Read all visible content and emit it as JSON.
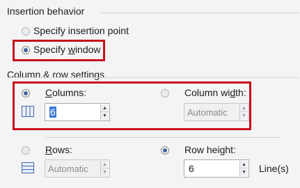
{
  "insertion": {
    "group_title": "Insertion behavior",
    "specify_point_label": "Specify insertion point",
    "specify_window_label_prefix": "Specify ",
    "specify_window_label_u": "w",
    "specify_window_label_suffix": "indow"
  },
  "colrow": {
    "group_title": "Column & row settings",
    "columns_label_u": "C",
    "columns_label_suffix": "olumns:",
    "columns_value": "6",
    "column_width_label_prefix": "Column wi",
    "column_width_label_u": "d",
    "column_width_label_suffix": "th:",
    "column_width_value": "Automatic",
    "rows_label_u": "R",
    "rows_label_suffix": "ows:",
    "rows_value": "Automatic",
    "row_height_label_prefix": "Row hei",
    "row_height_label_u": "g",
    "row_height_label_suffix": "ht:",
    "row_height_value": "6",
    "row_height_unit": "Line(s)"
  },
  "colors": {
    "highlight_border": "#c8101c",
    "radio_selected": "#3f64a0",
    "selection": "#3a7bd5"
  }
}
